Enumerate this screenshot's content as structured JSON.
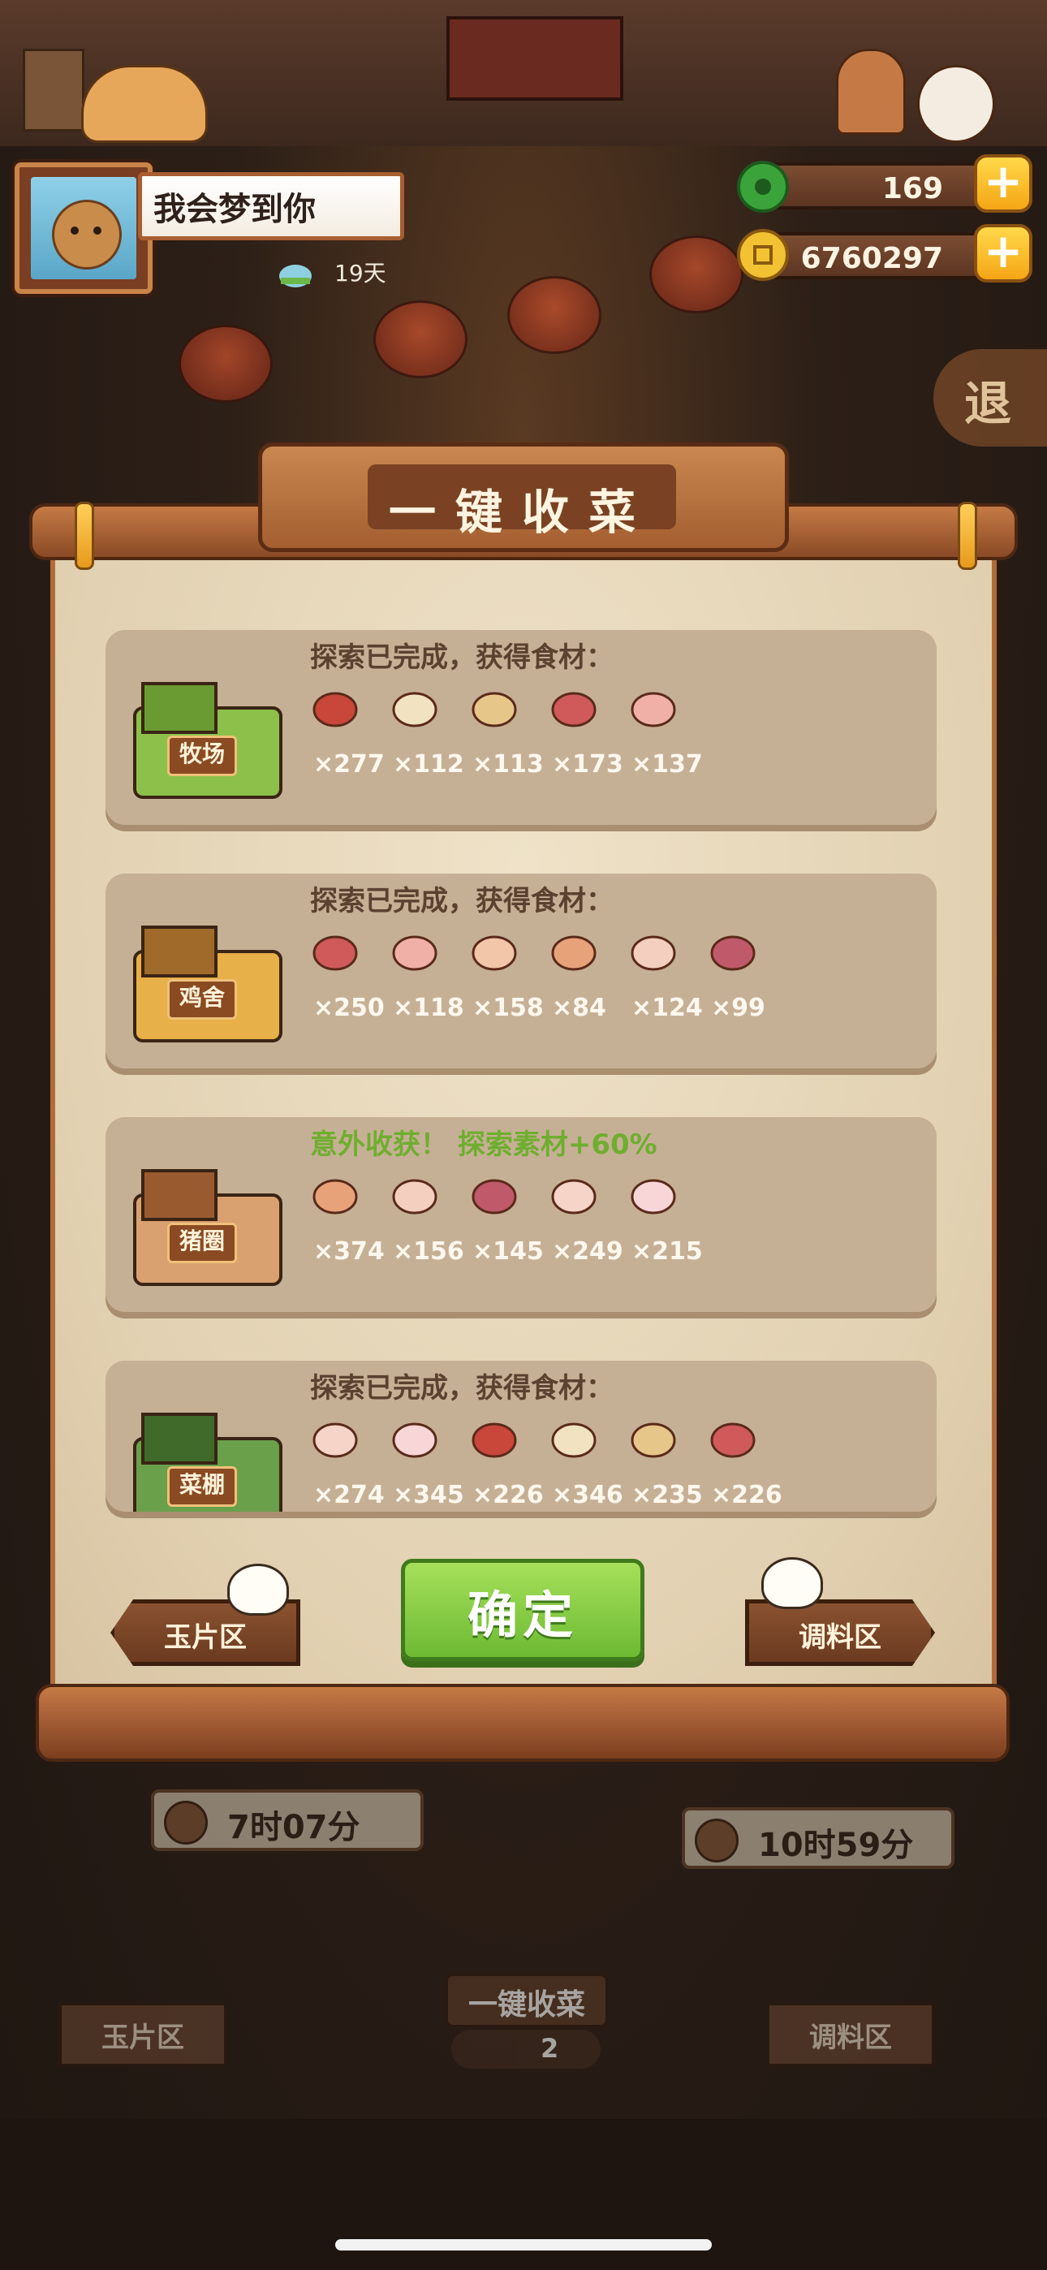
{
  "player": {
    "name": "我会梦到你",
    "days": "19天"
  },
  "currencies": {
    "jade": "169",
    "coins": "6760297"
  },
  "exit_label": "退",
  "dialog": {
    "title": "一键收菜",
    "cards": [
      {
        "place": "牧场",
        "status": "探索已完成，获得食材：",
        "status_highlight": false,
        "items": [
          {
            "icon": "meat-chunk-icon",
            "count": "×277"
          },
          {
            "icon": "milk-jar-icon",
            "count": "×112"
          },
          {
            "icon": "tripe-icon",
            "count": "×113"
          },
          {
            "icon": "beef-steak-icon",
            "count": "×173"
          },
          {
            "icon": "marbled-beef-icon",
            "count": "×137"
          }
        ]
      },
      {
        "place": "鸡舍",
        "status": "探索已完成，获得食材：",
        "status_highlight": false,
        "items": [
          {
            "icon": "egg-icon",
            "count": "×250"
          },
          {
            "icon": "chicken-breast-icon",
            "count": "×118"
          },
          {
            "icon": "whole-chicken-icon",
            "count": "×158"
          },
          {
            "icon": "chicken-meat-icon",
            "count": "×84"
          },
          {
            "icon": "drumstick-icon",
            "count": "×124"
          },
          {
            "icon": "chicken-wing-icon",
            "count": "×99"
          }
        ]
      },
      {
        "place": "猪圈",
        "status": "意外收获！ 探索素材+60%",
        "status_highlight": true,
        "items": [
          {
            "icon": "pork-belly-icon",
            "count": "×374"
          },
          {
            "icon": "lard-bowl-icon",
            "count": "×156"
          },
          {
            "icon": "pork-cuts-icon",
            "count": "×145"
          },
          {
            "icon": "ham-icon",
            "count": "×249"
          },
          {
            "icon": "pork-leg-icon",
            "count": "×215"
          }
        ]
      },
      {
        "place": "菜棚",
        "status": "探索已完成，获得食材：",
        "status_highlight": false,
        "items": [
          {
            "icon": "greens-icon",
            "count": "×274"
          },
          {
            "icon": "tomato-icon",
            "count": "×345"
          },
          {
            "icon": "green-pepper-icon",
            "count": "×226"
          },
          {
            "icon": "cucumber-icon",
            "count": "×346"
          },
          {
            "icon": "mushroom-box-icon",
            "count": "×235"
          },
          {
            "icon": "radish-icon",
            "count": "×226"
          }
        ]
      }
    ],
    "confirm_label": "确定",
    "left_nav": "玉片区",
    "right_nav": "调料区"
  },
  "background": {
    "timer_left": "7时07分",
    "timer_right": "10时59分",
    "left_sign": "玉片区",
    "right_sign": "调料区",
    "harvest_label": "一键收菜",
    "harvest_count": "2"
  },
  "colors": {
    "accent_green": "#6fae2f",
    "wood": "#a45e30",
    "paper": "#e3d3b6",
    "card": "#c6b095"
  }
}
